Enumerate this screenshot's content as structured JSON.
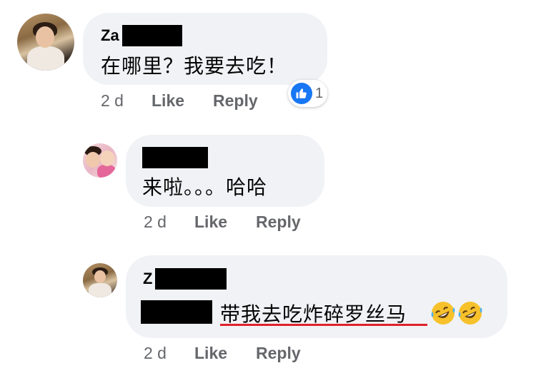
{
  "comments": [
    {
      "author_visible": "Za",
      "text": "在哪里？我要去吃！",
      "time": "2 d",
      "like_label": "Like",
      "reply_label": "Reply",
      "reaction_count": "1"
    },
    {
      "author_visible": "",
      "text": "来啦。。。哈哈",
      "time": "2 d",
      "like_label": "Like",
      "reply_label": "Reply"
    },
    {
      "author_visible": "Z",
      "text": "带我去吃炸碎罗丝马",
      "time": "2 d",
      "like_label": "Like",
      "reply_label": "Reply",
      "emoji": "rolling-on-floor-laughing-icon"
    }
  ],
  "colors": {
    "bubble": "#f0f2f5",
    "meta_text": "#65676b",
    "like_blue": "#1877f2",
    "underline_red": "#e0212a"
  }
}
